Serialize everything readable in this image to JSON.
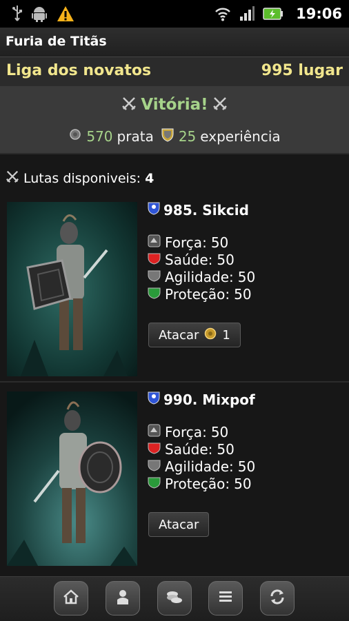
{
  "status_bar": {
    "time": "19:06",
    "icons": [
      "usb-icon",
      "android-icon",
      "warning-icon",
      "wifi-icon",
      "signal-icon",
      "battery-icon"
    ]
  },
  "app": {
    "title": "Furia de Titãs"
  },
  "league": {
    "name": "Liga dos novatos",
    "rank": "995 lugar"
  },
  "result": {
    "title": "Vitória!",
    "silver_value": "570",
    "silver_label": "prata",
    "xp_value": "25",
    "xp_label": "experiência"
  },
  "fights": {
    "label": "Lutas disponiveis:",
    "count": "4"
  },
  "opponents": [
    {
      "name": "985. Sikcid",
      "stats": [
        {
          "label": "Força:",
          "value": "50"
        },
        {
          "label": "Saúde:",
          "value": "50"
        },
        {
          "label": "Agilidade:",
          "value": "50"
        },
        {
          "label": "Proteção:",
          "value": "50"
        }
      ],
      "attack_label": "Atacar",
      "attack_cost": "1"
    },
    {
      "name": "990. Mixpof",
      "stats": [
        {
          "label": "Força:",
          "value": "50"
        },
        {
          "label": "Saúde:",
          "value": "50"
        },
        {
          "label": "Agilidade:",
          "value": "50"
        },
        {
          "label": "Proteção:",
          "value": "50"
        }
      ],
      "attack_label": "Atacar"
    }
  ],
  "bottom_nav": [
    "home-icon",
    "profile-icon",
    "coins-icon",
    "list-icon",
    "refresh-icon"
  ],
  "colors": {
    "accent_yellow": "#f1e68d",
    "victory_green": "#a6d38a",
    "background": "#171717"
  }
}
